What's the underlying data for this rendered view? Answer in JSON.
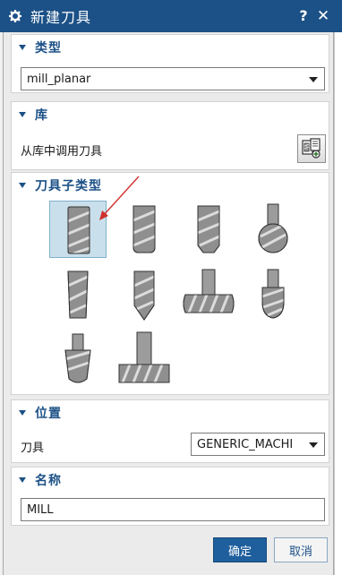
{
  "window": {
    "title": "新建刀具",
    "help_label": "?",
    "close_label": "✕"
  },
  "sections": {
    "type": {
      "header": "类型",
      "selected_value": "mill_planar"
    },
    "library": {
      "header": "库",
      "label": "从库中调用刀具",
      "button_icon": "library-icon"
    },
    "subtype": {
      "header": "刀具子类型",
      "tools": [
        {
          "name": "flat-end-mill",
          "selected": true
        },
        {
          "name": "bull-nose-end-mill",
          "selected": false
        },
        {
          "name": "chamfer-end-mill",
          "selected": false
        },
        {
          "name": "ball-mill",
          "selected": false
        },
        {
          "name": "taper-mill",
          "selected": false
        },
        {
          "name": "pointed-taper-mill",
          "selected": false
        },
        {
          "name": "barrel-mill",
          "selected": false
        },
        {
          "name": "lollipop-mill",
          "selected": false
        },
        {
          "name": "dovetail-mill",
          "selected": false
        },
        {
          "name": "t-slot-cutter",
          "selected": false
        }
      ]
    },
    "location": {
      "header": "位置",
      "tool_label": "刀具",
      "tool_value": "GENERIC_MACHI"
    },
    "name": {
      "header": "名称",
      "value": "MILL"
    }
  },
  "buttons": {
    "ok": "确定",
    "cancel": "取消"
  },
  "colors": {
    "titlebar": "#1c5187",
    "accent": "#1c5187",
    "selection": "#c9e0ec",
    "annotation_arrow": "#d0312d"
  }
}
